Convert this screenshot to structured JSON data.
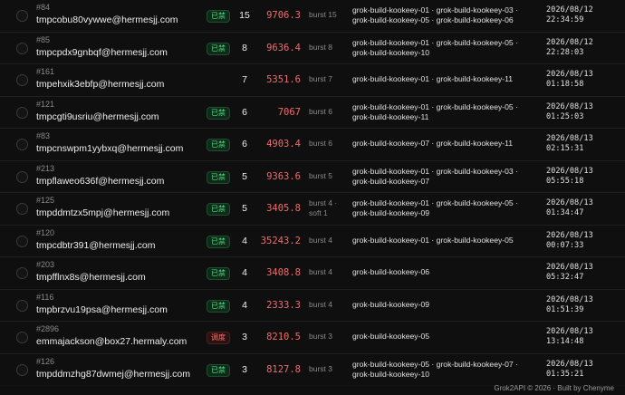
{
  "rows": [
    {
      "id": "#84",
      "email": "tmpcobu80vywwe@hermesjj.com",
      "badge": "已禁",
      "badge_type": "green",
      "count": "15",
      "value": "9706.3",
      "burst": [
        "burst 15"
      ],
      "keys": [
        "grok-build-kookeey-01 · grok-build-kookeey-03 ·",
        "grok-build-kookeey-05 · grok-build-kookeey-06"
      ],
      "time": [
        "2026/08/12",
        "22:34:59"
      ]
    },
    {
      "id": "#85",
      "email": "tmpcpdx9gnbqf@hermesjj.com",
      "badge": "已禁",
      "badge_type": "green",
      "count": "8",
      "value": "9636.4",
      "burst": [
        "burst 8"
      ],
      "keys": [
        "grok-build-kookeey-01 · grok-build-kookeey-05 ·",
        "grok-build-kookeey-10"
      ],
      "time": [
        "2026/08/12",
        "22:28:03"
      ]
    },
    {
      "id": "#161",
      "email": "tmpehxik3ebfp@hermesjj.com",
      "badge": "",
      "badge_type": "",
      "count": "7",
      "value": "5351.6",
      "burst": [
        "burst 7"
      ],
      "keys": [
        "grok-build-kookeey-01 · grok-build-kookeey-11"
      ],
      "time": [
        "2026/08/13",
        "01:18:58"
      ]
    },
    {
      "id": "#121",
      "email": "tmpcgti9usriu@hermesjj.com",
      "badge": "已禁",
      "badge_type": "green",
      "count": "6",
      "value": "7067",
      "burst": [
        "burst 6"
      ],
      "keys": [
        "grok-build-kookeey-01 · grok-build-kookeey-05 ·",
        "grok-build-kookeey-11"
      ],
      "time": [
        "2026/08/13",
        "01:25:03"
      ]
    },
    {
      "id": "#83",
      "email": "tmpcnswpm1yybxq@hermesjj.com",
      "badge": "已禁",
      "badge_type": "green",
      "count": "6",
      "value": "4903.4",
      "burst": [
        "burst 6"
      ],
      "keys": [
        "grok-build-kookeey-07 · grok-build-kookeey-11"
      ],
      "time": [
        "2026/08/13",
        "02:15:31"
      ]
    },
    {
      "id": "#213",
      "email": "tmpflaweo636f@hermesjj.com",
      "badge": "已禁",
      "badge_type": "green",
      "count": "5",
      "value": "9363.6",
      "burst": [
        "burst 5"
      ],
      "keys": [
        "grok-build-kookeey-01 · grok-build-kookeey-03 ·",
        "grok-build-kookeey-07"
      ],
      "time": [
        "2026/08/13",
        "05:55:18"
      ]
    },
    {
      "id": "#125",
      "email": "tmpddmtzx5mpj@hermesjj.com",
      "badge": "已禁",
      "badge_type": "green",
      "count": "5",
      "value": "3405.8",
      "burst": [
        "burst 4 ·",
        "soft 1"
      ],
      "keys": [
        "grok-build-kookeey-01 · grok-build-kookeey-05 ·",
        "grok-build-kookeey-09"
      ],
      "time": [
        "2026/08/13",
        "01:34:47"
      ]
    },
    {
      "id": "#120",
      "email": "tmpcdbtr391@hermesjj.com",
      "badge": "已禁",
      "badge_type": "green",
      "count": "4",
      "value": "35243.2",
      "burst": [
        "burst 4"
      ],
      "keys": [
        "grok-build-kookeey-01 · grok-build-kookeey-05"
      ],
      "time": [
        "2026/08/13",
        "00:07:33"
      ]
    },
    {
      "id": "#203",
      "email": "tmpfflnx8s@hermesjj.com",
      "badge": "已禁",
      "badge_type": "green",
      "count": "4",
      "value": "3408.8",
      "burst": [
        "burst 4"
      ],
      "keys": [
        "grok-build-kookeey-06"
      ],
      "time": [
        "2026/08/13",
        "05:32:47"
      ]
    },
    {
      "id": "#116",
      "email": "tmpbrzvu19psa@hermesjj.com",
      "badge": "已禁",
      "badge_type": "green",
      "count": "4",
      "value": "2333.3",
      "burst": [
        "burst 4"
      ],
      "keys": [
        "grok-build-kookeey-09"
      ],
      "time": [
        "2026/08/13",
        "01:51:39"
      ]
    },
    {
      "id": "#2896",
      "email": "emmajackson@box27.hermaly.com",
      "badge": "调度",
      "badge_type": "red",
      "count": "3",
      "value": "8210.5",
      "burst": [
        "burst 3"
      ],
      "keys": [
        "grok-build-kookeey-05"
      ],
      "time": [
        "2026/08/13",
        "13:14:48"
      ]
    },
    {
      "id": "#126",
      "email": "tmpddmzhg87dwmej@hermesjj.com",
      "badge": "已禁",
      "badge_type": "green",
      "count": "3",
      "value": "8127.8",
      "burst": [
        "burst 3"
      ],
      "keys": [
        "grok-build-kookeey-05 · grok-build-kookeey-07 ·",
        "grok-build-kookeey-10"
      ],
      "time": [
        "2026/08/13",
        "01:35:21"
      ]
    }
  ],
  "footer": {
    "text": "Grok2API  © 2026  ·  Built by  Chenyme"
  }
}
